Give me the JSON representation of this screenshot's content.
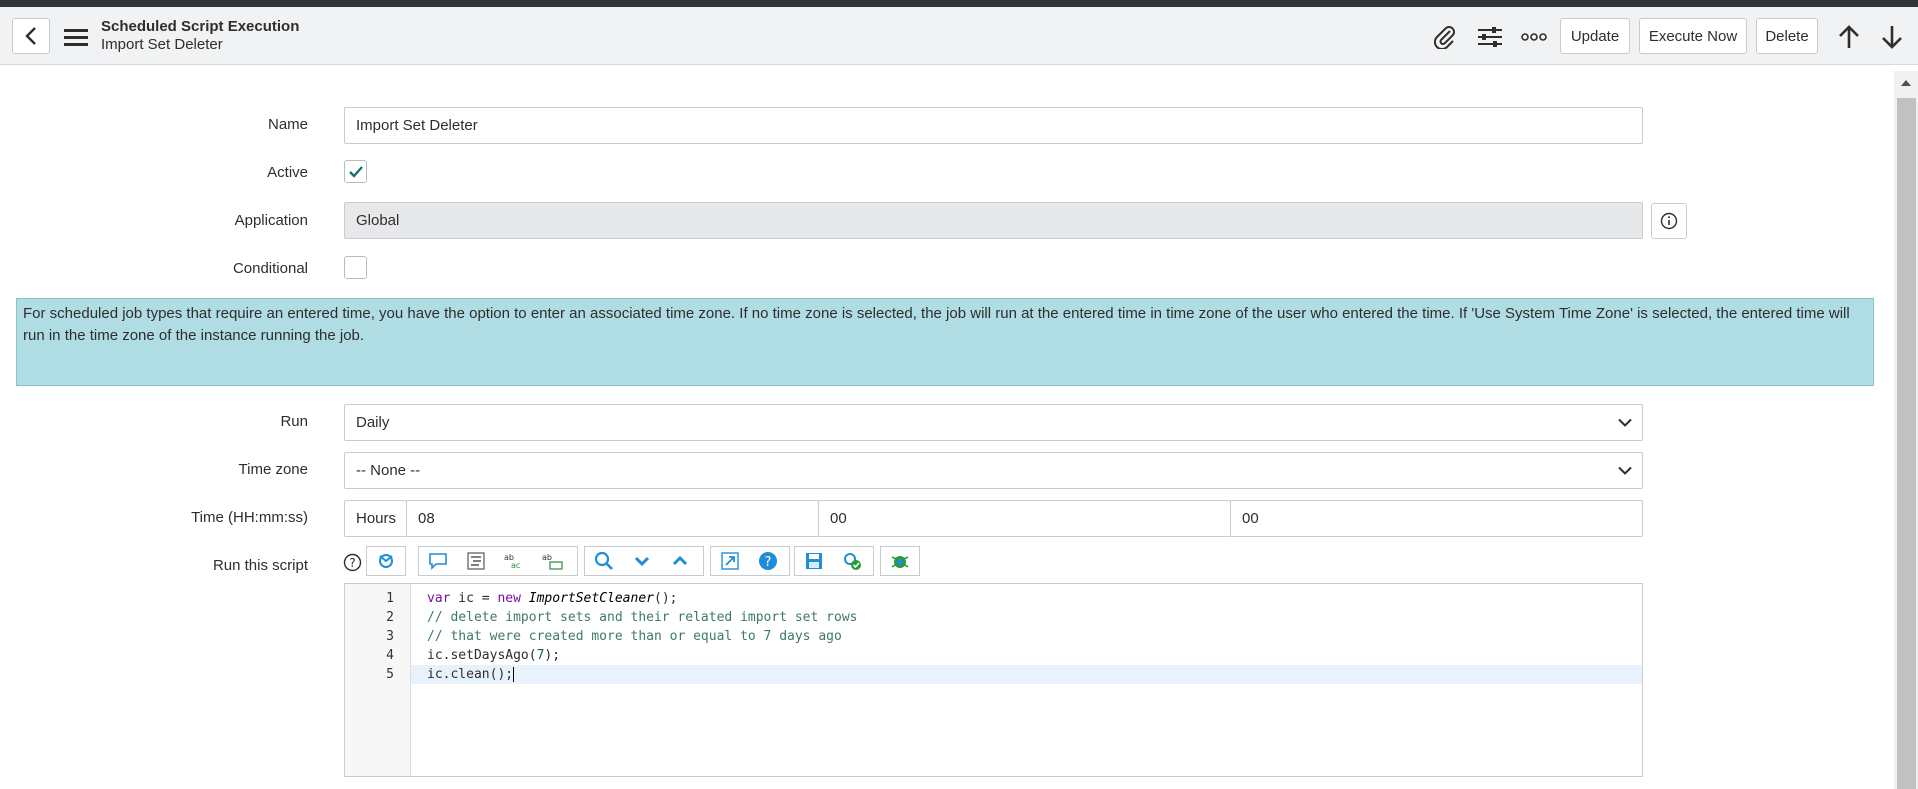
{
  "header": {
    "back_icon": "chevron-left-icon",
    "menu_icon": "hamburger-icon",
    "title": "Scheduled Script Execution",
    "subtitle": "Import Set Deleter",
    "attach_icon": "paperclip-icon",
    "settings_icon": "sliders-icon",
    "more_icon": "more-horizontal-icon",
    "update_label": "Update",
    "execute_label": "Execute Now",
    "delete_label": "Delete",
    "up_icon": "arrow-up-icon",
    "down_icon": "arrow-down-icon"
  },
  "form": {
    "name_label": "Name",
    "name_value": "Import Set Deleter",
    "active_label": "Active",
    "active_checked": true,
    "application_label": "Application",
    "application_value": "Global",
    "conditional_label": "Conditional",
    "conditional_checked": false,
    "info_text": "For scheduled job types that require an entered time, you have the option to enter an associated time zone. If no time zone is selected, the job will run at the entered time in time zone of the user who entered the time. If 'Use System Time Zone' is selected, the entered time will run in the time zone of the instance running the job.",
    "run_label": "Run",
    "run_value": "Daily",
    "timezone_label": "Time zone",
    "timezone_value": "-- None --",
    "time_label": "Time (HH:mm:ss)",
    "hours_label": "Hours",
    "hours_value": "08",
    "minutes_value": "00",
    "seconds_value": "00",
    "script_label": "Run this script"
  },
  "script": {
    "lines": [
      {
        "n": "1"
      },
      {
        "n": "2",
        "text": "// delete import sets and their related import set rows"
      },
      {
        "n": "3",
        "text": "// that were created more than or equal to 7 days ago"
      },
      {
        "n": "4"
      },
      {
        "n": "5",
        "text": "ic.clean();"
      }
    ],
    "l1_var": "var",
    "l1_ic": " ic = ",
    "l1_new": "new",
    "l1_cls": "ImportSetCleaner",
    "l1_end": "();",
    "l4_a": "ic.setDaysAgo(",
    "l4_num": "7",
    "l4_b": ");"
  },
  "colors": {
    "header_bg": "#f1f2f3",
    "info_bg": "#b0dde3",
    "check_color": "#1d6f72",
    "link_blue": "#1f8ed8"
  }
}
